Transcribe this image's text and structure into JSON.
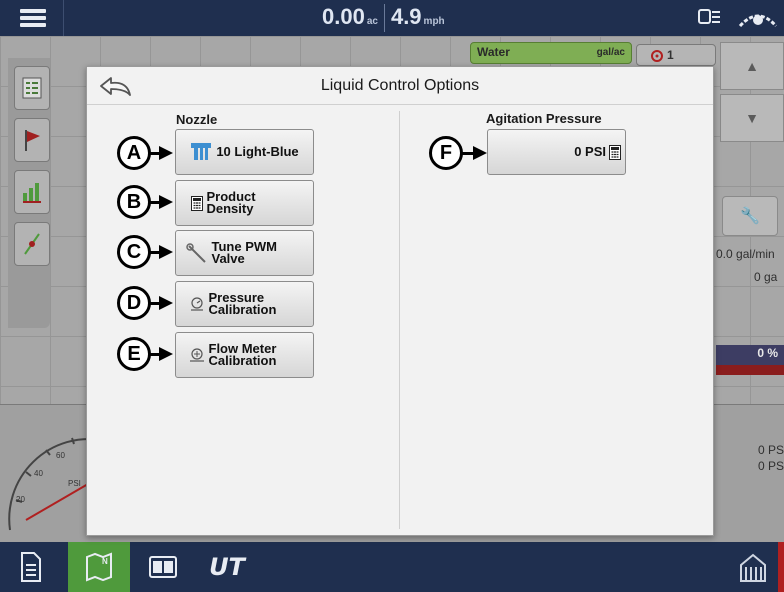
{
  "topbar": {
    "area_value": "0.00",
    "area_unit": "ac",
    "speed_value": "4.9",
    "speed_unit": "mph"
  },
  "map_overlay": {
    "product_name": "Water",
    "product_unit": "gal/ac",
    "target_count": "1",
    "flow_rate": "0.0 gal/min",
    "volume": "0 ga",
    "percent": "0 %",
    "pressure_1": "0 PS",
    "pressure_2": "0 PS",
    "gauge_label": "PSI",
    "gauge_ticks": [
      "20",
      "40",
      "60"
    ]
  },
  "dialog": {
    "title": "Liquid Control Options",
    "nozzle_label": "Nozzle",
    "agitation_label": "Agitation Pressure",
    "buttons": {
      "nozzle": "10 Light-Blue",
      "product_density": "Product Density",
      "tune_pwm": "Tune PWM Valve",
      "pressure_cal": "Pressure Calibration",
      "flow_meter_cal": "Flow Meter Calibration",
      "agitation": "0 PSI"
    },
    "callouts": {
      "a": "A",
      "b": "B",
      "c": "C",
      "d": "D",
      "e": "E",
      "f": "F"
    }
  },
  "bottombar": {
    "ut_label": "UT"
  },
  "colors": {
    "bar": "#1f2f4f",
    "active_tab": "#4f9a3c",
    "product": "#7fae54",
    "dialog_bg": "#f2f2f2"
  },
  "icons": [
    "menu-icon",
    "implement-icon",
    "gps-icon",
    "back-icon",
    "nozzle-icon",
    "calculator-icon",
    "wrench-icon",
    "gauge-icon",
    "flow-meter-icon",
    "document-icon",
    "map-icon",
    "split-view-icon",
    "barn-icon"
  ]
}
